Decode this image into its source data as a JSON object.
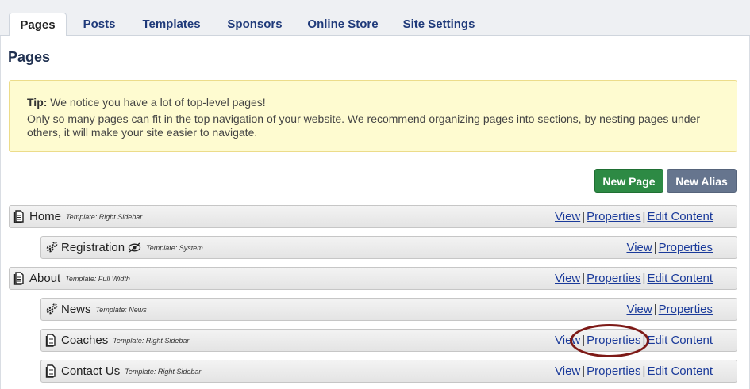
{
  "tabs": [
    {
      "label": "Pages",
      "active": true
    },
    {
      "label": "Posts"
    },
    {
      "label": "Templates"
    },
    {
      "label": "Sponsors"
    },
    {
      "label": "Online Store"
    },
    {
      "label": "Site Settings"
    }
  ],
  "page_title": "Pages",
  "tip": {
    "label": "Tip:",
    "headline": "We notice you have a lot of top-level pages!",
    "body": "Only so many pages can fit in the top navigation of your website. We recommend organizing pages into sections, by nesting pages under others, it will make your site easier to navigate."
  },
  "buttons": {
    "new_page": "New Page",
    "new_alias": "New Alias"
  },
  "colors": {
    "accent_green": "#2d8a44",
    "accent_slate": "#66758e",
    "link": "#1a3a9a",
    "highlight": "#7d1a17"
  },
  "actions": {
    "view": "View",
    "properties": "Properties",
    "edit_content": "Edit Content",
    "sep": "|"
  },
  "rows": [
    {
      "name": "Home",
      "template": "Template: Right Sidebar",
      "icon": "page-icon"
    },
    {
      "name": "Registration",
      "template": "Template: System",
      "icon": "gears-icon"
    },
    {
      "name": "About",
      "template": "Template: Full Width",
      "icon": "page-icon"
    },
    {
      "name": "News",
      "template": "Template: News",
      "icon": "gears-icon"
    },
    {
      "name": "Coaches",
      "template": "Template: Right Sidebar",
      "icon": "page-icon"
    },
    {
      "name": "Contact Us",
      "template": "Template: Right Sidebar",
      "icon": "page-icon"
    }
  ]
}
